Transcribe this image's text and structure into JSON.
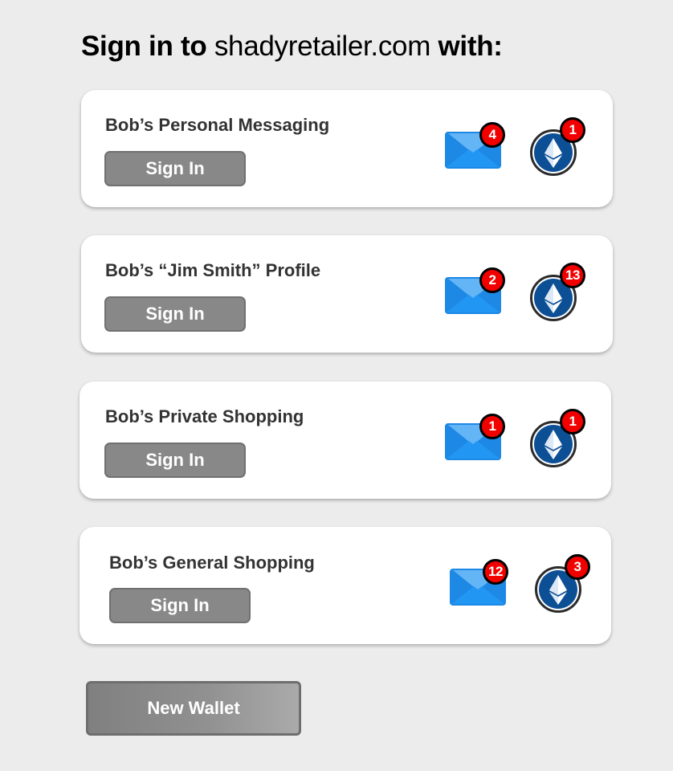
{
  "heading": {
    "prefix": "Sign in to",
    "domain": "shadyretailer.com",
    "suffix": "with:"
  },
  "accounts": [
    {
      "name": "Bob’s Personal Messaging",
      "button_label": "Sign In",
      "mail_count": "4",
      "eth_count": "1"
    },
    {
      "name": "Bob’s “Jim Smith” Profile",
      "button_label": "Sign In",
      "mail_count": "2",
      "eth_count": "13"
    },
    {
      "name": "Bob’s Private Shopping",
      "button_label": "Sign In",
      "mail_count": "1",
      "eth_count": "1"
    },
    {
      "name": "Bob’s General Shopping",
      "button_label": "Sign In",
      "mail_count": "12",
      "eth_count": "3"
    }
  ],
  "new_wallet_label": "New Wallet",
  "icons": {
    "mail": "envelope-icon",
    "wallet": "ethereum-icon"
  },
  "colors": {
    "background": "#ececec",
    "card": "#ffffff",
    "button": "#888888",
    "envelope": "#2196f3",
    "ethereum_badge": "#0d4f95",
    "notification": "#f20000"
  }
}
